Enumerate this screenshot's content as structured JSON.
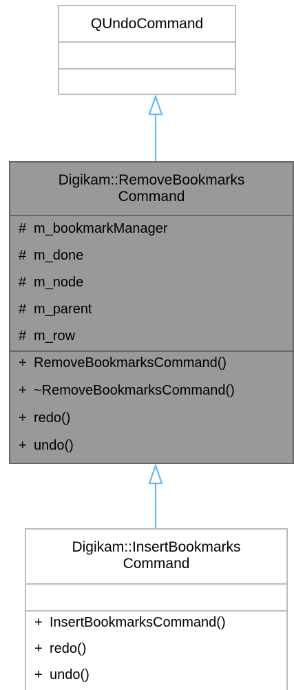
{
  "diagram": {
    "base_class": {
      "name": "QUndoCommand"
    },
    "main_class": {
      "name_line1": "Digikam::RemoveBookmarks",
      "name_line2": "Command",
      "attributes": [
        {
          "vis": "#",
          "name": "m_bookmarkManager"
        },
        {
          "vis": "#",
          "name": "m_done"
        },
        {
          "vis": "#",
          "name": "m_node"
        },
        {
          "vis": "#",
          "name": "m_parent"
        },
        {
          "vis": "#",
          "name": "m_row"
        }
      ],
      "methods": [
        {
          "vis": "+",
          "name": "RemoveBookmarksCommand()"
        },
        {
          "vis": "+",
          "name": "~RemoveBookmarksCommand()"
        },
        {
          "vis": "+",
          "name": "redo()"
        },
        {
          "vis": "+",
          "name": "undo()"
        }
      ]
    },
    "derived_class": {
      "name_line1": "Digikam::InsertBookmarks",
      "name_line2": "Command",
      "methods": [
        {
          "vis": "+",
          "name": "InsertBookmarksCommand()"
        },
        {
          "vis": "+",
          "name": "redo()"
        },
        {
          "vis": "+",
          "name": "undo()"
        }
      ]
    },
    "colors": {
      "arrow": "#63b8ff",
      "main_fill": "#999999",
      "main_border": "#666666",
      "plain_border": "#bcbcbc"
    }
  }
}
